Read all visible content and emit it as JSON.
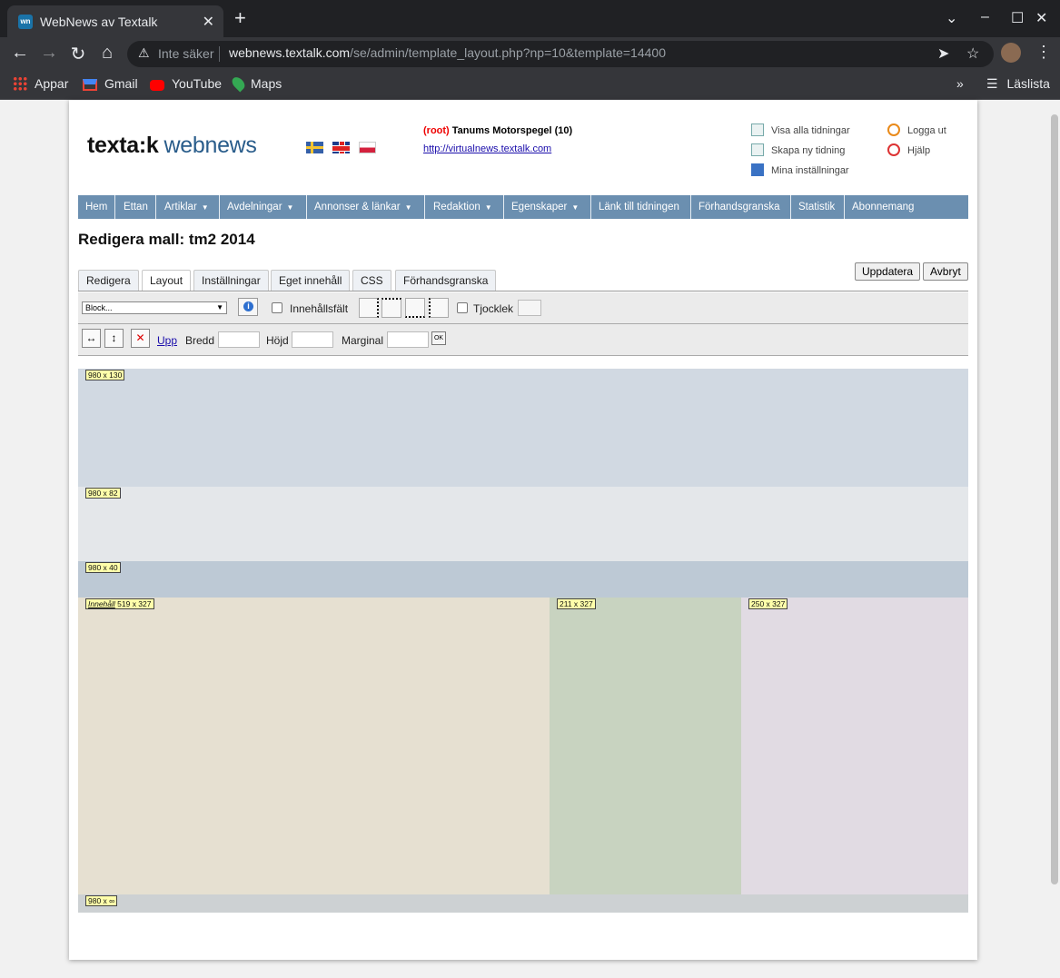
{
  "browser": {
    "tab_title": "WebNews av Textalk",
    "favicon_text": "wn",
    "address": {
      "security_label": "Inte säker",
      "host": "webnews.textalk.com",
      "path": "/se/admin/template_layout.php?np=10&template=14400"
    },
    "bookmarks": {
      "items": [
        {
          "label": "Appar",
          "icon": "apps-grid-icon"
        },
        {
          "label": "Gmail",
          "icon": "gmail-icon"
        },
        {
          "label": "YouTube",
          "icon": "youtube-icon"
        },
        {
          "label": "Maps",
          "icon": "maps-icon"
        }
      ],
      "reading_list": "Läslista"
    }
  },
  "header": {
    "logo_part1": "texta:k",
    "logo_part2": "webnews",
    "flags": [
      "sweden-flag-icon",
      "uk-flag-icon",
      "poland-flag-icon"
    ],
    "root_label": "(root)",
    "paper_name": "Tanums Motorspegel (10)",
    "paper_url": "http://virtualnews.textalk.com",
    "links": {
      "view_all": "Visa alla tidningar",
      "create_new": "Skapa ny tidning",
      "my_settings": "Mina inställningar",
      "logout": "Logga ut",
      "help": "Hjälp"
    }
  },
  "nav": {
    "items": [
      {
        "label": "Hem",
        "dropdown": false
      },
      {
        "label": "Ettan",
        "dropdown": false
      },
      {
        "label": "Artiklar",
        "dropdown": true
      },
      {
        "label": "Avdelningar",
        "dropdown": true
      },
      {
        "label": "Annonser & länkar",
        "dropdown": true
      },
      {
        "label": "Redaktion",
        "dropdown": true
      },
      {
        "label": "Egenskaper",
        "dropdown": true
      },
      {
        "label": "Länk till tidningen",
        "dropdown": false
      },
      {
        "label": "Förhandsgranska",
        "dropdown": false
      },
      {
        "label": "Statistik",
        "dropdown": false
      },
      {
        "label": "Abonnemang",
        "dropdown": false
      }
    ]
  },
  "editor": {
    "title": "Redigera mall: tm2 2014",
    "tabs": [
      {
        "label": "Redigera",
        "active": false
      },
      {
        "label": "Layout",
        "active": true
      },
      {
        "label": "Inställningar",
        "active": false
      },
      {
        "label": "Eget innehåll",
        "active": false
      },
      {
        "label": "CSS",
        "active": false
      },
      {
        "label": "Förhandsgranska",
        "active": false
      }
    ],
    "update_button": "Uppdatera",
    "cancel_button": "Avbryt",
    "toolbar1": {
      "block_select_value": "Block...",
      "content_field_label": "Innehållsfält",
      "thickness_label": "Tjocklek"
    },
    "toolbar2": {
      "up_link": "Upp",
      "width_label": "Bredd",
      "height_label": "Höjd",
      "margin_label": "Marginal",
      "ok_label": "OK"
    }
  },
  "layout_blocks": {
    "b1": {
      "size_label": "980 x 130",
      "color": "#d1d9e2"
    },
    "b2": {
      "size_label": "980 x 82",
      "color": "#e4e7ea"
    },
    "b3": {
      "size_label": "980 x 40",
      "color": "#bdc9d5"
    },
    "b4": {
      "content_label": "Innehåll",
      "size_label": "519 x 327",
      "color": "#e6e0d1"
    },
    "b5": {
      "size_label": "211 x 327",
      "color": "#c8d3c0"
    },
    "b6": {
      "size_label": "250 x 327",
      "color": "#e1dbe3"
    },
    "b7": {
      "size_label": "980 x ∞",
      "color": "#cdd1d3"
    }
  }
}
